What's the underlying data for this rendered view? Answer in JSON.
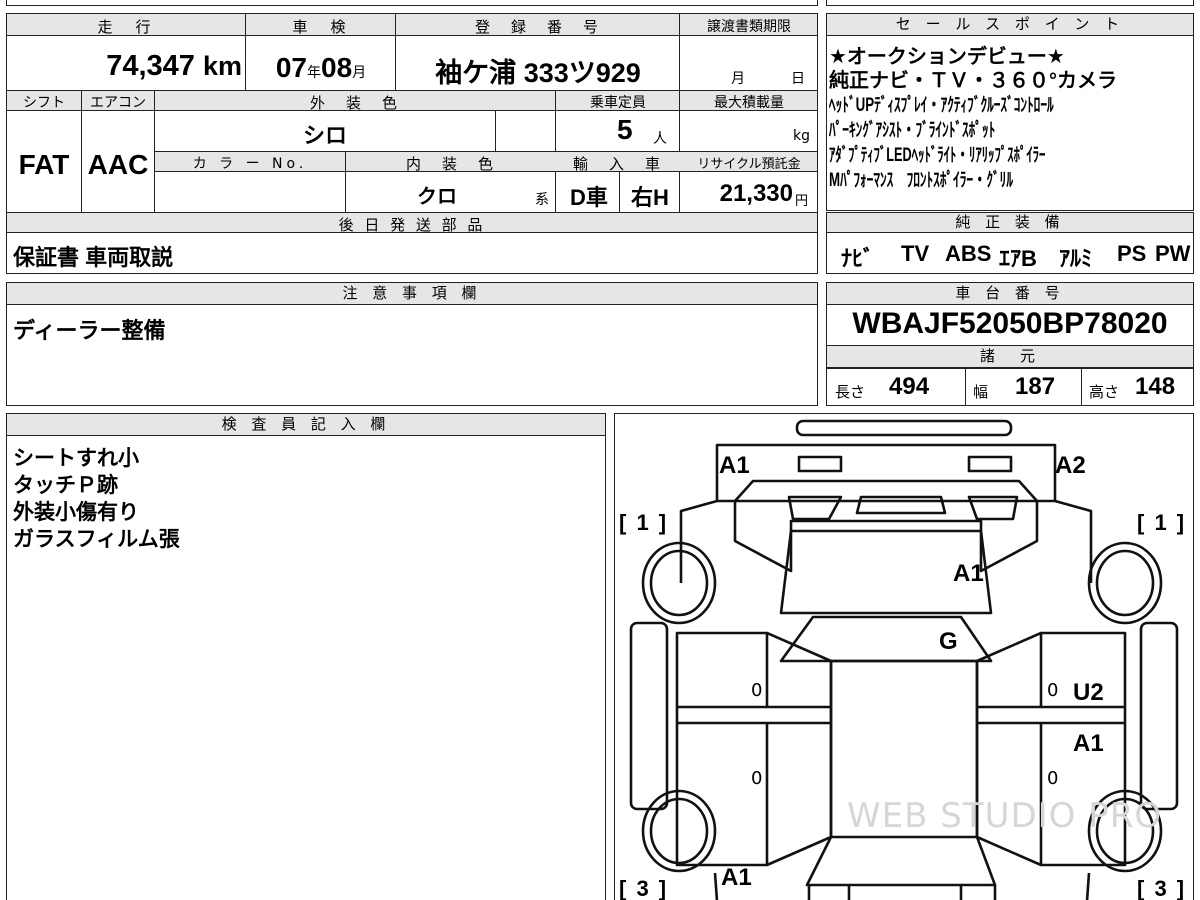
{
  "header": {
    "mileage_label": "走　行",
    "mileage_value": "74,347",
    "mileage_unit": "km",
    "shaken_label": "車　検",
    "shaken_year": "07",
    "shaken_year_unit": "年",
    "shaken_month": "08",
    "shaken_month_unit": "月",
    "plate_label": "登　録　番　号",
    "plate_value": "袖ケ浦 333ツ929",
    "transfer_label": "譲渡書類期限",
    "transfer_month_unit": "月",
    "transfer_day_unit": "日",
    "shift_label": "シフト",
    "shift_value": "FAT",
    "aircon_label": "エアコン",
    "aircon_value": "AAC",
    "exterior_label": "外　装　色",
    "exterior_value": "シロ",
    "capacity_label": "乗車定員",
    "capacity_value": "5",
    "capacity_unit": "人",
    "maxload_label": "最大積載量",
    "maxload_unit": "kg",
    "colorno_label": "カ ラ ー No.",
    "interior_label": "内　装　色",
    "interior_value": "クロ",
    "interior_suffix": "系",
    "import_label": "輸　入　車",
    "import_value": "D車",
    "handle_value": "右H",
    "recycle_label": "リサイクル預託金",
    "recycle_value": "21,330",
    "recycle_unit": "円",
    "later_parts_label": "後 日 発 送 部 品",
    "later_parts_value": "保証書 車両取説"
  },
  "sales": {
    "label": "セ ー ル ス ポ イ ン ト",
    "lines": [
      "★オークションデビュー★",
      "純正ナビ・ＴＶ・３６０°カメラ",
      "ﾍｯﾄﾞUPﾃﾞｨｽﾌﾟﾚｲ・ｱｸﾃｨﾌﾞｸﾙｰｽﾞｺﾝﾄﾛｰﾙ",
      "ﾊﾟｰｷﾝｸﾞｱｼｽﾄ・ﾌﾞﾗｲﾝﾄﾞｽﾎﾟｯﾄ",
      "ｱﾀﾞﾌﾟﾃｨﾌﾞLEDﾍｯﾄﾞﾗｲﾄ・ﾘｱﾘｯﾌﾟｽﾎﾟｲﾗｰ",
      "Mﾊﾟﾌｫｰﾏﾝｽ　ﾌﾛﾝﾄｽﾎﾟｲﾗｰ・ｸﾞﾘﾙ"
    ]
  },
  "equipment": {
    "label": "純 正 装 備",
    "items": [
      "ﾅﾋﾞ",
      "TV",
      "ABS",
      "ｴｱB",
      "ｱﾙﾐ",
      "PS",
      "PW"
    ]
  },
  "notes": {
    "label": "注 意 事 項 欄",
    "value": "ディーラー整備"
  },
  "chassis": {
    "label": "車 台 番 号",
    "value": "WBAJF52050BP78020"
  },
  "dimensions": {
    "label": "諸　元",
    "length_label": "長さ",
    "length_value": "494",
    "width_label": "幅",
    "width_value": "187",
    "height_label": "高さ",
    "height_value": "148"
  },
  "inspector": {
    "label": "検 査 員 記 入 欄",
    "lines": [
      "シートすれ小",
      "タッチＰ跡",
      "外装小傷有り",
      "ガラスフィルム張"
    ]
  },
  "diagram": {
    "marks": [
      {
        "id": "front-left",
        "text": "A1"
      },
      {
        "id": "front-right",
        "text": "A2"
      },
      {
        "id": "hood",
        "text": "A1"
      },
      {
        "id": "windshield",
        "text": "G"
      },
      {
        "id": "right-front-door",
        "text": "U2"
      },
      {
        "id": "right-rear-door",
        "text": "A1"
      },
      {
        "id": "rear-left",
        "text": "A1"
      }
    ],
    "tire_marks": {
      "front_left": "[ 1 ]",
      "front_right": "[ 1 ]",
      "rear_left": "[ 3 ]",
      "rear_right": "[ 3 ]"
    },
    "door_zeros": [
      "0",
      "0",
      "0",
      "0"
    ],
    "watermark": "WEB STUDIO PRO"
  }
}
